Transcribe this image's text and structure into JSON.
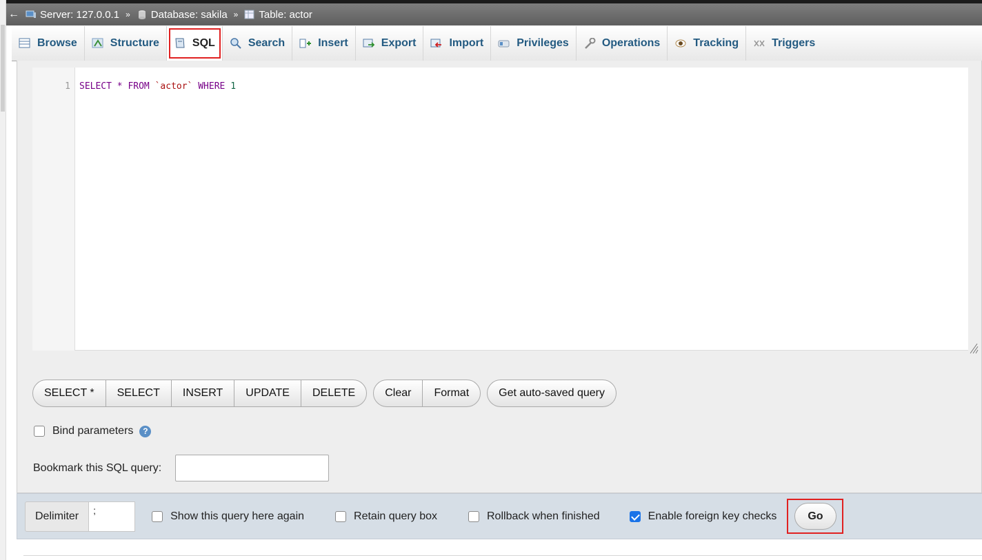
{
  "breadcrumb": {
    "back": "←",
    "server": "Server: 127.0.0.1",
    "database": "Database: sakila",
    "table": "Table: actor",
    "separator": "»"
  },
  "tabs": [
    {
      "label": "Browse",
      "icon": "browse-icon"
    },
    {
      "label": "Structure",
      "icon": "structure-icon"
    },
    {
      "label": "SQL",
      "icon": "sql-icon",
      "active": true
    },
    {
      "label": "Search",
      "icon": "search-icon"
    },
    {
      "label": "Insert",
      "icon": "insert-icon"
    },
    {
      "label": "Export",
      "icon": "export-icon"
    },
    {
      "label": "Import",
      "icon": "import-icon"
    },
    {
      "label": "Privileges",
      "icon": "privileges-icon"
    },
    {
      "label": "Operations",
      "icon": "operations-icon"
    },
    {
      "label": "Tracking",
      "icon": "tracking-icon"
    },
    {
      "label": "Triggers",
      "icon": "triggers-icon"
    }
  ],
  "editor": {
    "line_number": "1",
    "tokens": {
      "select": "SELECT",
      "star": "*",
      "from": "FROM",
      "table": "`actor`",
      "where": "WHERE",
      "one": "1"
    }
  },
  "query_buttons": {
    "group1": [
      "SELECT *",
      "SELECT",
      "INSERT",
      "UPDATE",
      "DELETE"
    ],
    "group2": [
      "Clear",
      "Format"
    ],
    "group3": [
      "Get auto-saved query"
    ]
  },
  "bind_parameters": {
    "label": "Bind parameters",
    "checked": false,
    "help": "?"
  },
  "bookmark": {
    "label": "Bookmark this SQL query:",
    "value": ""
  },
  "footer": {
    "delimiter_label": "Delimiter",
    "delimiter_value": ";",
    "show_query_again": {
      "label": "Show this query here again",
      "checked": false
    },
    "retain_query_box": {
      "label": "Retain query box",
      "checked": false
    },
    "rollback": {
      "label": "Rollback when finished",
      "checked": false
    },
    "foreign_key_checks": {
      "label": "Enable foreign key checks",
      "checked": true
    },
    "go": "Go"
  },
  "colors": {
    "accent": "#235a81",
    "highlight": "#e02020",
    "checkbox_checked": "#1a73e8"
  }
}
